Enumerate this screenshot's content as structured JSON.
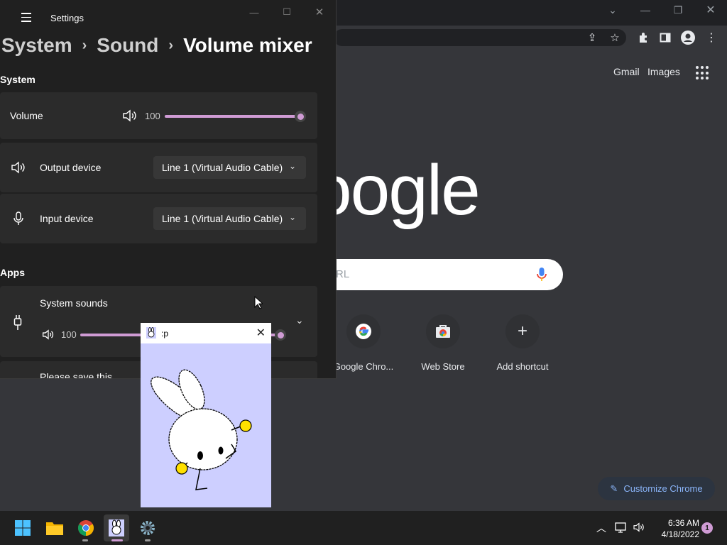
{
  "chrome": {
    "header_links": {
      "gmail": "Gmail",
      "images": "Images"
    },
    "logo_text": "oogle",
    "search_placeholder": "RL",
    "shortcuts": [
      {
        "label": "Google Chro...",
        "icon": "google-g-icon"
      },
      {
        "label": "Web Store",
        "icon": "web-store-icon"
      },
      {
        "label": "Add shortcut",
        "icon": "plus-icon"
      }
    ],
    "customize_label": "Customize Chrome"
  },
  "settings": {
    "window_title": "Settings",
    "breadcrumb": {
      "item1": "System",
      "item2": "Sound",
      "current": "Volume mixer"
    },
    "system_header": "System",
    "volume": {
      "label": "Volume",
      "value": "100",
      "level": 1.0
    },
    "output": {
      "label": "Output device",
      "value": "Line 1 (Virtual Audio Cable)"
    },
    "input": {
      "label": "Input device",
      "value": "Line 1 (Virtual Audio Cable)"
    },
    "apps_header": "Apps",
    "app_sound": {
      "label": "System sounds",
      "value": "100",
      "level": 1.0
    },
    "partial_label": "Please save this"
  },
  "mini_window": {
    "title": ":p"
  },
  "taskbar": {
    "time": "6:36 AM",
    "date": "4/18/2022",
    "notifications": "1"
  },
  "colors": {
    "accent": "#cf9bd4",
    "chrome_bg": "#35363a",
    "settings_bg": "#202020"
  }
}
